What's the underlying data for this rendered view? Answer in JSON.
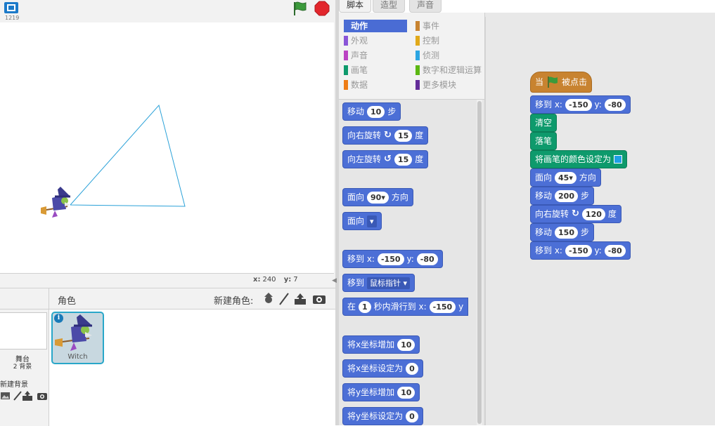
{
  "stage": {
    "version": "1219",
    "coords": {
      "x_label": "x:",
      "x_value": "240",
      "y_label": "y:",
      "y_value": "7"
    }
  },
  "sprites": {
    "title": "角色",
    "new_sprite_label": "新建角色:",
    "stage_name": "舞台",
    "stage_bg_count": "2 背景",
    "new_backdrop_label": "新建背景",
    "selected_sprite": {
      "name": "Witch",
      "info": "i"
    }
  },
  "tabs": [
    {
      "label": "脚本",
      "active": true
    },
    {
      "label": "造型",
      "active": false
    },
    {
      "label": "声音",
      "active": false
    }
  ],
  "categories": [
    {
      "label": "动作",
      "color": "#4a6cd4",
      "active": true
    },
    {
      "label": "外观",
      "color": "#8a55d7",
      "active": false
    },
    {
      "label": "声音",
      "color": "#bb42c3",
      "active": false
    },
    {
      "label": "画笔",
      "color": "#0e9a6c",
      "active": false
    },
    {
      "label": "数据",
      "color": "#ee7d16",
      "active": false
    },
    {
      "label": "事件",
      "color": "#c88330",
      "active": false
    },
    {
      "label": "控制",
      "color": "#e1a91a",
      "active": false
    },
    {
      "label": "侦测",
      "color": "#2ca5e2",
      "active": false
    },
    {
      "label": "数字和逻辑运算",
      "color": "#5cb712",
      "active": false
    },
    {
      "label": "更多模块",
      "color": "#632d99",
      "active": false
    }
  ],
  "palette": {
    "move": {
      "t1": "移动",
      "v": "10",
      "t2": "步"
    },
    "turn_right": {
      "t1": "向右旋转",
      "v": "15",
      "t2": "度"
    },
    "turn_left": {
      "t1": "向左旋转",
      "v": "15",
      "t2": "度"
    },
    "point_dir": {
      "t1": "面向",
      "v": "90▾",
      "t2": "方向"
    },
    "point_towards": {
      "t1": "面向",
      "v": "▾"
    },
    "goto_xy": {
      "t1": "移到 x:",
      "x": "-150",
      "t2": "y:",
      "y": "-80"
    },
    "goto_target": {
      "t1": "移到",
      "v": "鼠标指针 ▾"
    },
    "glide": {
      "t1": "在",
      "secs": "1",
      "t2": "秒内滑行到 x:",
      "x": "-150",
      "t3": "y"
    },
    "change_x": {
      "t1": "将x坐标增加",
      "v": "10"
    },
    "set_x": {
      "t1": "将x坐标设定为",
      "v": "0"
    },
    "change_y": {
      "t1": "将y坐标增加",
      "v": "10"
    },
    "set_y": {
      "t1": "将y坐标设定为",
      "v": "0"
    }
  },
  "script": {
    "hat": {
      "t1": "当",
      "t2": "被点击"
    },
    "goto1": {
      "t1": "移到 x:",
      "x": "-150",
      "t2": "y:",
      "y": "-80"
    },
    "clear": "清空",
    "pen_down": "落笔",
    "set_pen_color": "将画笔的颜色设定为",
    "point_dir": {
      "t1": "面向",
      "v": "45▾",
      "t2": "方向"
    },
    "move": {
      "t1": "移动",
      "v": "200",
      "t2": "步"
    },
    "turn_right": {
      "t1": "向右旋转",
      "v": "120",
      "t2": "度"
    },
    "move2": {
      "t1": "移动",
      "v": "150",
      "t2": "步"
    },
    "goto2": {
      "t1": "移到 x:",
      "x": "-150",
      "t2": "y:",
      "y": "-80"
    }
  }
}
